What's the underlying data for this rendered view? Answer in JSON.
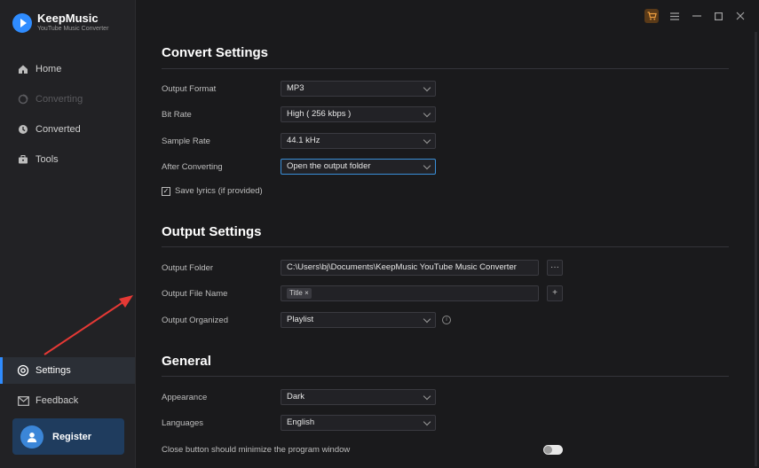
{
  "app": {
    "name": "KeepMusic",
    "subtitle": "YouTube Music Converter"
  },
  "sidebar": {
    "items": [
      {
        "label": "Home",
        "icon": "home-icon"
      },
      {
        "label": "Converting",
        "icon": "converting-icon"
      },
      {
        "label": "Converted",
        "icon": "clock-icon"
      },
      {
        "label": "Tools",
        "icon": "toolbox-icon"
      }
    ],
    "settings_label": "Settings",
    "feedback_label": "Feedback",
    "register_label": "Register"
  },
  "window_controls": {
    "icons": [
      "cart-icon",
      "menu-icon",
      "minimize-icon",
      "maximize-icon",
      "close-icon"
    ]
  },
  "convert_settings": {
    "title": "Convert Settings",
    "output_format": {
      "label": "Output Format",
      "value": "MP3"
    },
    "bit_rate": {
      "label": "Bit Rate",
      "value": "High ( 256 kbps )"
    },
    "sample_rate": {
      "label": "Sample Rate",
      "value": "44.1 kHz"
    },
    "after_converting": {
      "label": "After Converting",
      "value": "Open the output folder"
    },
    "save_lyrics": {
      "label": "Save lyrics (if provided)",
      "checked": true
    }
  },
  "output_settings": {
    "title": "Output Settings",
    "output_folder": {
      "label": "Output Folder",
      "value": "C:\\Users\\bj\\Documents\\KeepMusic YouTube Music Converter",
      "browse": "···"
    },
    "output_file_name": {
      "label": "Output File Name",
      "tag": "Title",
      "tag_close": "×",
      "add": "+"
    },
    "output_organized": {
      "label": "Output Organized",
      "value": "Playlist",
      "info": "i"
    }
  },
  "general": {
    "title": "General",
    "appearance": {
      "label": "Appearance",
      "value": "Dark"
    },
    "languages": {
      "label": "Languages",
      "value": "English"
    },
    "close_minimize": {
      "label": "Close button should minimize the program window",
      "enabled": false
    }
  },
  "colors": {
    "accent": "#2f8cff",
    "arrow": "#e53935"
  }
}
